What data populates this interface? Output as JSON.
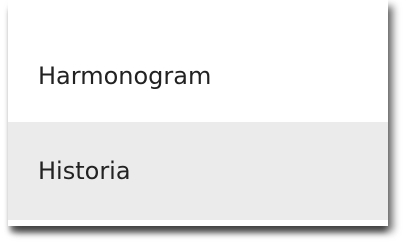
{
  "menu": {
    "items": [
      {
        "label": "Harmonogram",
        "selected": false
      },
      {
        "label": "Historia",
        "selected": true
      }
    ],
    "hover_color": "#ebebeb"
  }
}
